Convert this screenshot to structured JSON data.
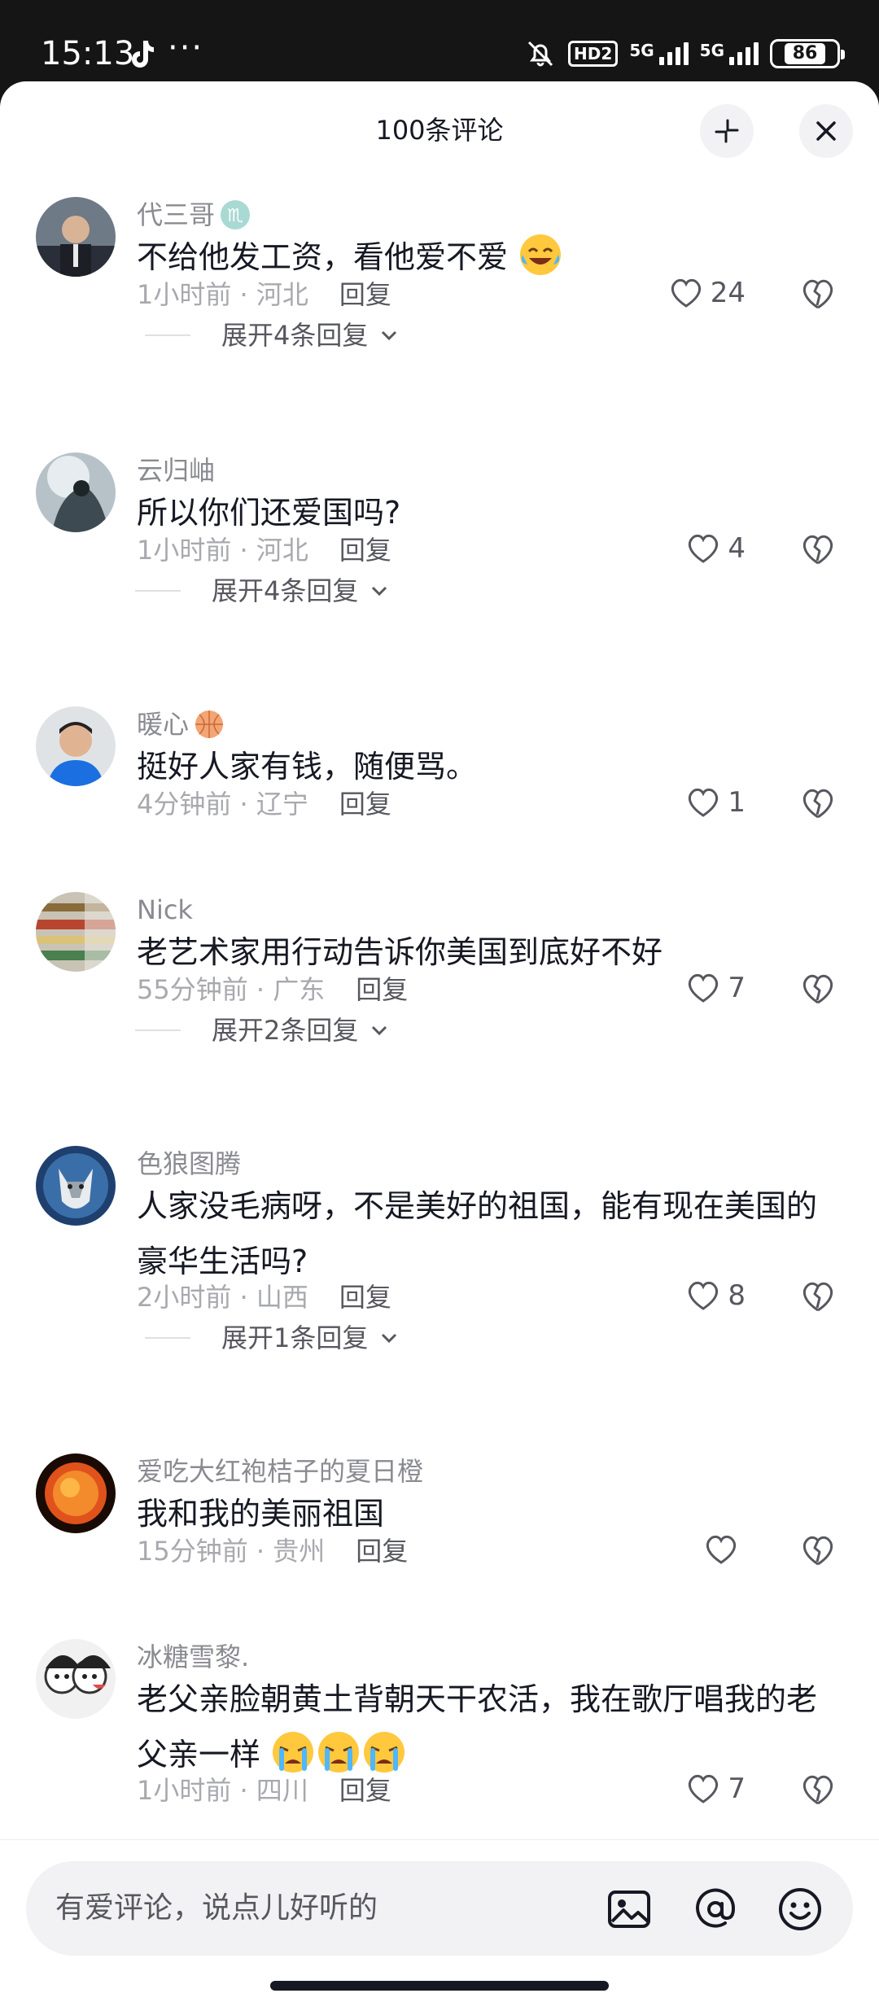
{
  "status_bar": {
    "time": "15:13",
    "more": "···",
    "hd": "HD2",
    "net_label": "5G",
    "battery": "86"
  },
  "header": {
    "title": "100条评论"
  },
  "comments": [
    {
      "name": "代三哥",
      "badge": "scorpio-zodiac-badge",
      "text": "不给他发工资，看他爱不爱",
      "emoji": "laughing-crying-emoji",
      "time": "1小时前",
      "location": "河北",
      "reply": "回复",
      "likes": "24",
      "expand": "展开4条回复"
    },
    {
      "name": "云归岫",
      "text": "所以你们还爱国吗?",
      "time": "1小时前",
      "location": "河北",
      "reply": "回复",
      "likes": "4",
      "expand": "展开4条回复"
    },
    {
      "name": "暖心",
      "badge": "basketball-badge",
      "text": "挺好人家有钱，随便骂。",
      "time": "4分钟前",
      "location": "辽宁",
      "reply": "回复",
      "likes": "1"
    },
    {
      "name": "Nick",
      "text": "老艺术家用行动告诉你美国到底好不好",
      "time": "55分钟前",
      "location": "广东",
      "reply": "回复",
      "likes": "7",
      "expand": "展开2条回复"
    },
    {
      "name": "色狼图腾",
      "text": "人家没毛病呀，不是美好的祖国，能有现在美国的豪华生活吗?",
      "time": "2小时前",
      "location": "山西",
      "reply": "回复",
      "likes": "8",
      "expand": "展开1条回复"
    },
    {
      "name": "爱吃大红袍桔子的夏日橙",
      "text": "我和我的美丽祖国",
      "time": "15分钟前",
      "location": "贵州",
      "reply": "回复",
      "likes": ""
    },
    {
      "name": "冰糖雪黎.",
      "text": "老父亲脸朝黄土背朝天干农活，我在歌厅唱我的老父亲一样",
      "emoji": "crying-emoji",
      "time": "1小时前",
      "location": "四川",
      "reply": "回复",
      "likes": "7"
    }
  ],
  "input": {
    "placeholder": "有爱评论，说点儿好听的"
  },
  "icons": [
    "tiktok-icon",
    "bell-muted-icon",
    "collapse-icon",
    "close-icon",
    "heart-icon",
    "broken-heart-icon",
    "image-icon",
    "at-icon",
    "emoji-icon"
  ],
  "colors": {
    "primary_text": "#161823",
    "secondary_text": "#8a8b91",
    "meta_text": "#a8a9ae",
    "icon_gray": "#57585f",
    "status_bg": "#151515"
  }
}
